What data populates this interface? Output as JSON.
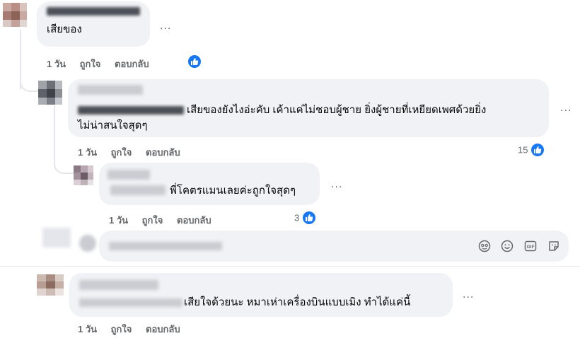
{
  "comments": [
    {
      "text": "เสียของ",
      "actions": {
        "time": "1 วัน",
        "like": "ถูกใจ",
        "reply": "ตอบกลับ"
      },
      "more": "..."
    },
    {
      "text_line1": "เสียของยังไงอ่ะคับ เค้าแค่ไม่ชอบผู้ชาย ยิ่งผู้ชายที่เหยียดเพศด้วยยิ่ง",
      "text_line2": "ไม่น่าสนใจสุดๆ",
      "actions": {
        "time": "1 วัน",
        "like": "ถูกใจ",
        "reply": "ตอบกลับ"
      },
      "reactions": "15",
      "more": "..."
    },
    {
      "text": "พี่โคตรแมนเลยค่ะถูกใจสุดๆ",
      "actions": {
        "time": "1 วัน",
        "like": "ถูกใจ",
        "reply": "ตอบกลับ"
      },
      "reactions": "3",
      "more": "..."
    },
    {
      "text": "เสียใจด้วยนะ หมาเห่าเครื่องบินแบบเมิง ทำได้แค่นี้",
      "actions": {
        "time": "1 วัน",
        "like": "ถูกใจ",
        "reply": "ตอบกลับ"
      },
      "more": "..."
    }
  ],
  "reply_box": {
    "tools": [
      "avatar-sticker-icon",
      "emoji-icon",
      "gif-icon",
      "sticker-icon"
    ]
  },
  "colors": {
    "accent": "#1877f2",
    "bubble": "#f0f2f5",
    "meta": "#65676b"
  }
}
